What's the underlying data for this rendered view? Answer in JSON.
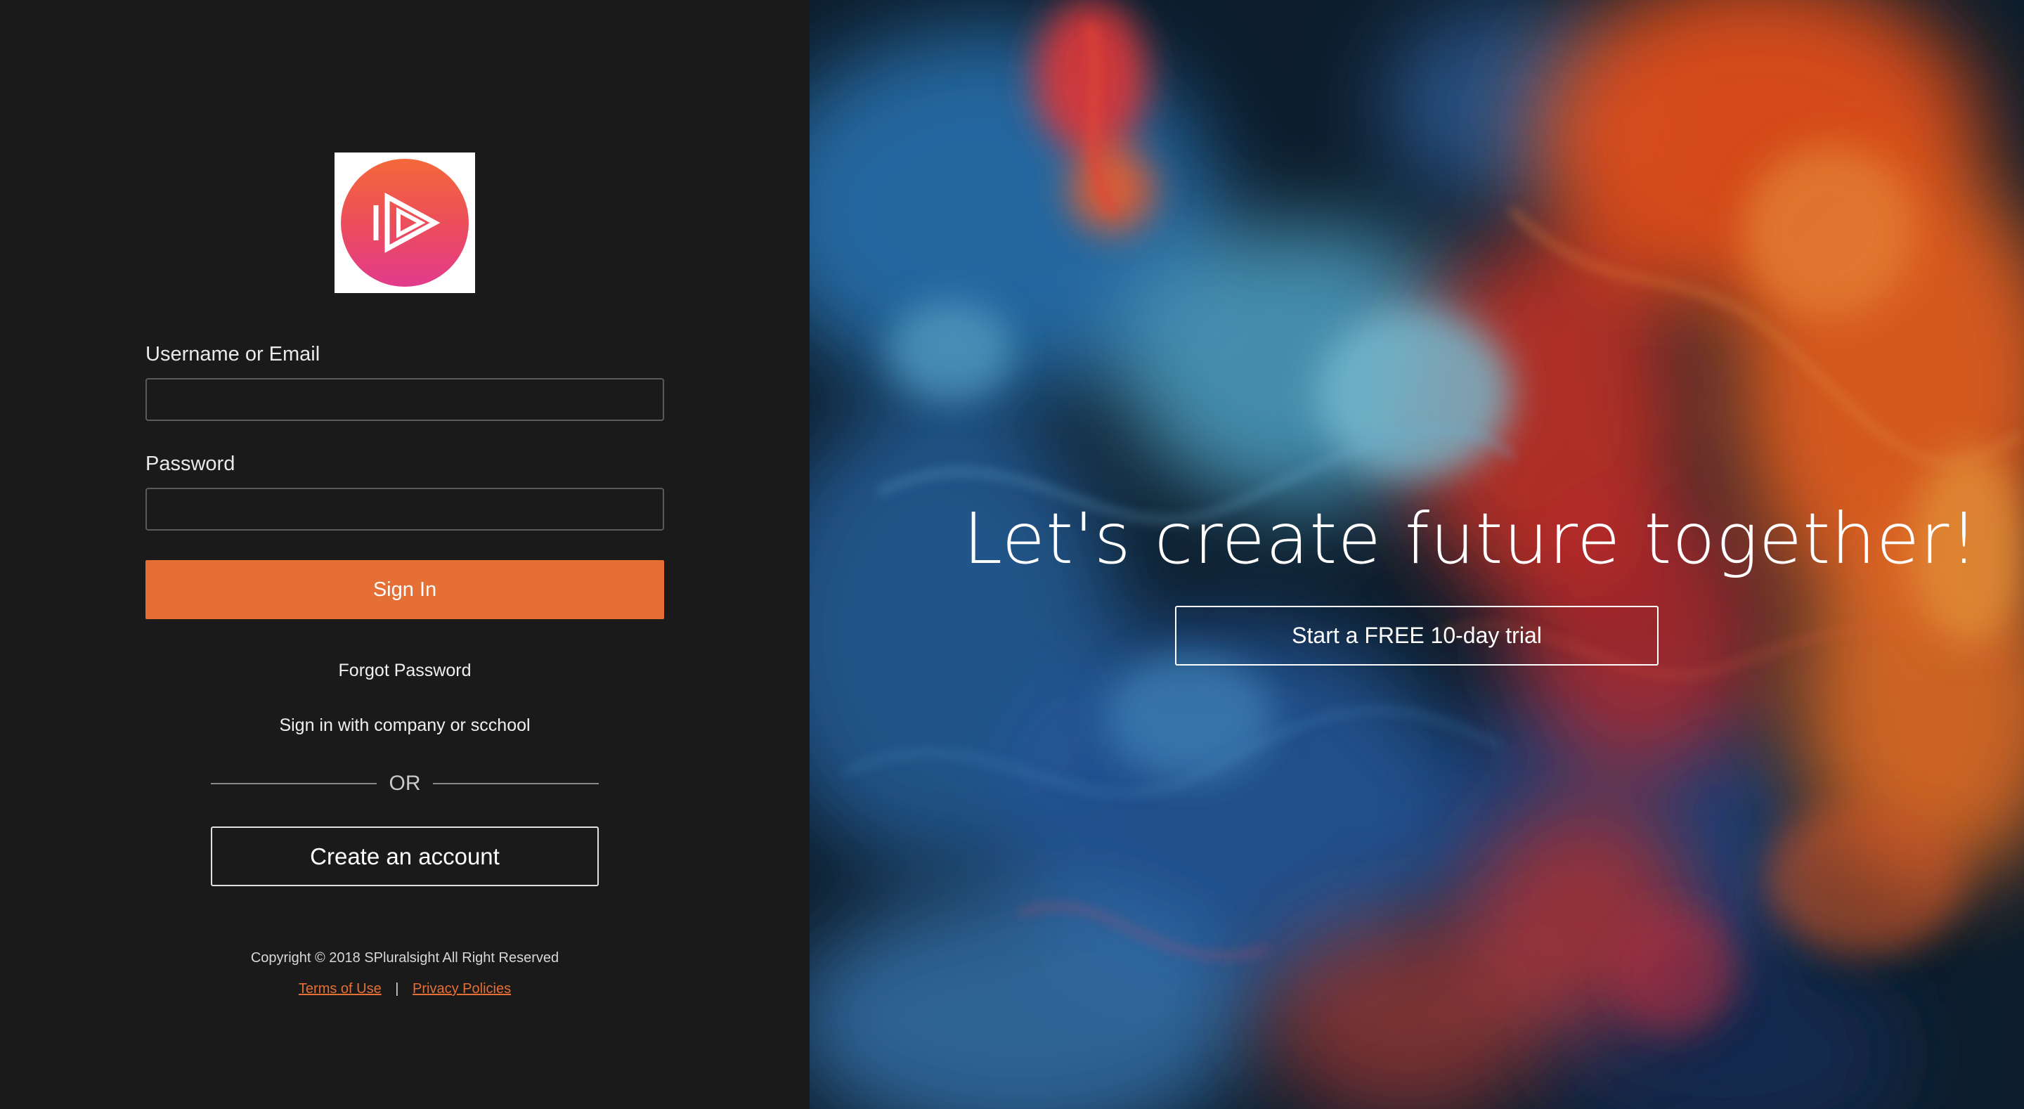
{
  "brand": {
    "logo_icon": "play-triangle-logo-icon",
    "accent_color": "#e66f35"
  },
  "login": {
    "username_label": "Username or Email",
    "username_value": "",
    "password_label": "Password",
    "password_value": "",
    "signin_label": "Sign In",
    "forgot_password": "Forgot Password",
    "company_signin": "Sign in with company or scchool",
    "or_text": "OR",
    "create_account": "Create an account"
  },
  "footer": {
    "copyright": "Copyright © 2018 SPluralsight All Right Reserved",
    "terms": "Terms of Use",
    "separator": "|",
    "privacy": "Privacy Policies"
  },
  "hero": {
    "title": "Let's create future together!",
    "trial_button": "Start a FREE 10-day trial"
  }
}
